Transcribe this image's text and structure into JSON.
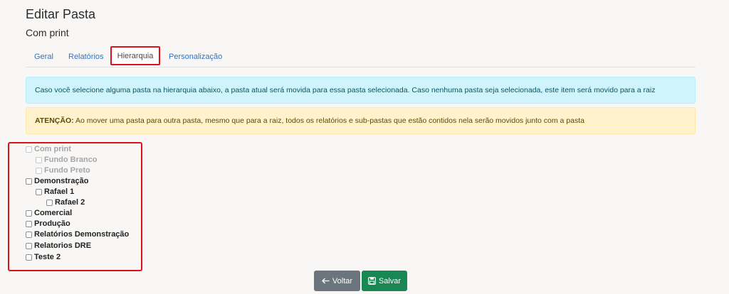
{
  "header": {
    "title": "Editar Pasta",
    "subtitle": "Com print"
  },
  "tabs": [
    {
      "label": "Geral"
    },
    {
      "label": "Relatórios"
    },
    {
      "label": "Hierarquia"
    },
    {
      "label": "Personalização"
    }
  ],
  "alerts": {
    "info": "Caso você selecione alguma pasta na hierarquia abaixo, a pasta atual será movida para essa pasta selecionada. Caso nenhuma pasta seja selecionada, este item será movido para a raiz",
    "warning_strong": "ATENÇÃO:",
    "warning": " Ao mover uma pasta para outra pasta, mesmo que para a raiz, todos os relatórios e sub-pastas que estão contidos nela serão movidos junto com a pasta"
  },
  "tree": [
    {
      "label": "Com print",
      "disabled": true
    },
    {
      "label": "Fundo Branco",
      "disabled": true
    },
    {
      "label": "Fundo Preto",
      "disabled": true
    },
    {
      "label": "Demonstração",
      "disabled": false
    },
    {
      "label": "Rafael 1",
      "disabled": false
    },
    {
      "label": "Rafael 2",
      "disabled": false
    },
    {
      "label": "Comercial",
      "disabled": false
    },
    {
      "label": "Produção",
      "disabled": false
    },
    {
      "label": "Relatórios Demonstração",
      "disabled": false
    },
    {
      "label": "Relatorios DRE",
      "disabled": false
    },
    {
      "label": "Teste 2",
      "disabled": false
    }
  ],
  "buttons": {
    "back": {
      "label": "Voltar",
      "icon": "arrow-left-icon"
    },
    "save": {
      "label": "Salvar",
      "icon": "floppy-disk-icon"
    }
  },
  "colors": {
    "info_bg": "#cff4fb",
    "warning_bg": "#fff2cc",
    "highlight": "#e0101a",
    "save_button": "#198754",
    "back_button": "#6c757d",
    "tab_link": "#2e73c8"
  }
}
